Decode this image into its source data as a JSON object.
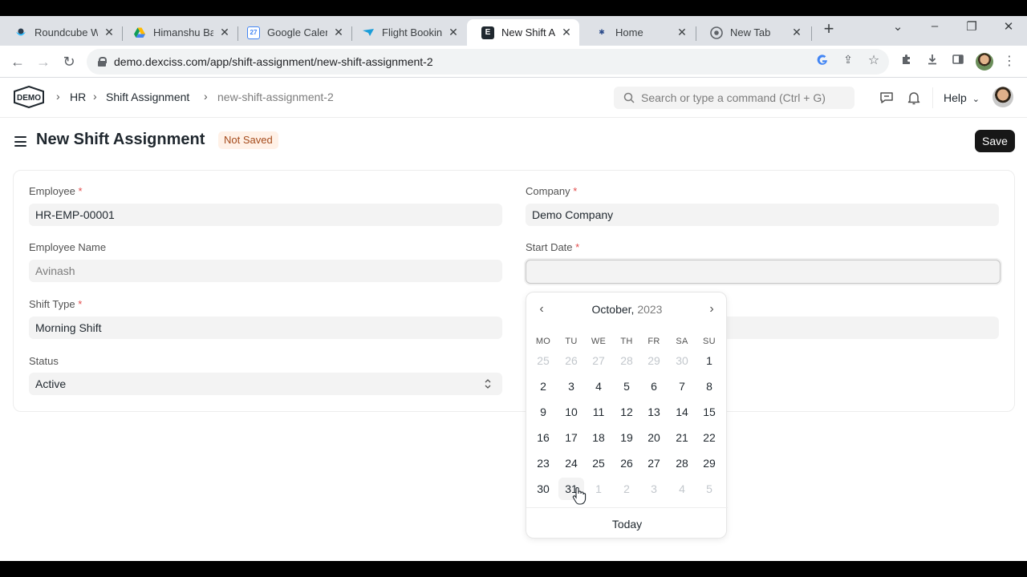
{
  "browser": {
    "tabs": [
      {
        "label": "Roundcube W",
        "icon": "roundcube-icon"
      },
      {
        "label": "Himanshu Bar",
        "icon": "google-drive-icon"
      },
      {
        "label": "Google Calend",
        "icon": "google-calendar-icon",
        "icon_text": "27"
      },
      {
        "label": "Flight Booking",
        "icon": "flight-icon"
      },
      {
        "label": "New Shift Assi",
        "icon": "erpnext-icon",
        "icon_text": "E",
        "active": true
      },
      {
        "label": "Home",
        "icon": "dexciss-icon"
      },
      {
        "label": "New Tab",
        "icon": "chrome-icon"
      }
    ],
    "url": "demo.dexciss.com/app/shift-assignment/new-shift-assignment-2"
  },
  "navbar": {
    "logo_text": "DEMO",
    "breadcrumbs": [
      "HR",
      "Shift Assignment",
      "new-shift-assignment-2"
    ],
    "search_placeholder": "Search or type a command (Ctrl + G)",
    "help_label": "Help"
  },
  "page": {
    "title": "New Shift Assignment",
    "status_badge": "Not Saved",
    "save_label": "Save"
  },
  "form": {
    "employee": {
      "label": "Employee",
      "value": "HR-EMP-00001"
    },
    "employee_name": {
      "label": "Employee Name",
      "value": "Avinash"
    },
    "shift_type": {
      "label": "Shift Type",
      "value": "Morning Shift"
    },
    "status": {
      "label": "Status",
      "value": "Active"
    },
    "company": {
      "label": "Company",
      "value": "Demo Company"
    },
    "start_date": {
      "label": "Start Date",
      "value": ""
    },
    "required_mark": "*"
  },
  "datepicker": {
    "month": "October,",
    "year": "2023",
    "weekdays": [
      "MO",
      "TU",
      "WE",
      "TH",
      "FR",
      "SA",
      "SU"
    ],
    "weeks": [
      [
        "25",
        "26",
        "27",
        "28",
        "29",
        "30",
        "1"
      ],
      [
        "2",
        "3",
        "4",
        "5",
        "6",
        "7",
        "8"
      ],
      [
        "9",
        "10",
        "11",
        "12",
        "13",
        "14",
        "15"
      ],
      [
        "16",
        "17",
        "18",
        "19",
        "20",
        "21",
        "22"
      ],
      [
        "23",
        "24",
        "25",
        "26",
        "27",
        "28",
        "29"
      ],
      [
        "30",
        "31",
        "1",
        "2",
        "3",
        "4",
        "5"
      ]
    ],
    "other_month": [
      [
        true,
        true,
        true,
        true,
        true,
        true,
        false
      ],
      [
        false,
        false,
        false,
        false,
        false,
        false,
        false
      ],
      [
        false,
        false,
        false,
        false,
        false,
        false,
        false
      ],
      [
        false,
        false,
        false,
        false,
        false,
        false,
        false
      ],
      [
        false,
        false,
        false,
        false,
        false,
        false,
        false
      ],
      [
        false,
        false,
        true,
        true,
        true,
        true,
        true
      ]
    ],
    "hovered_day": "31",
    "today_label": "Today"
  },
  "colors": {
    "save_button": "#171717",
    "badge_bg": "#fff1e7",
    "badge_text": "#a54b1c",
    "required": "#e24c4c"
  }
}
